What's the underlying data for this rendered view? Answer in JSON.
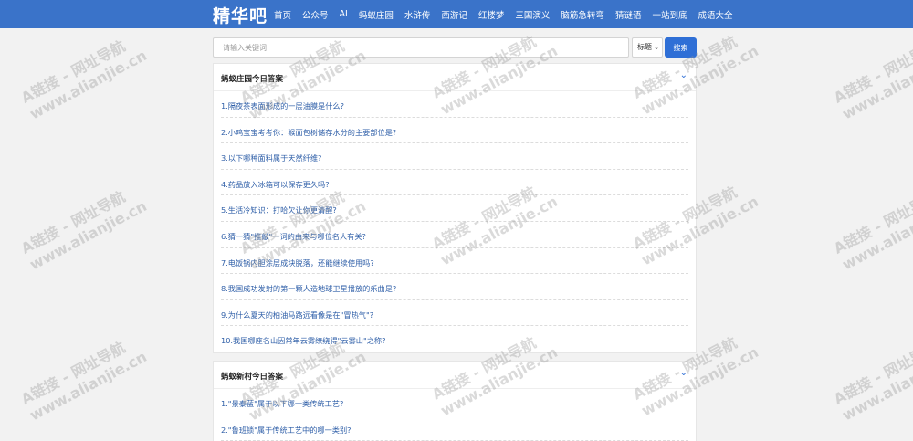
{
  "header": {
    "brand": "精华吧",
    "nav": [
      "首页",
      "公众号",
      "AI",
      "蚂蚁庄园",
      "水浒传",
      "西游记",
      "红楼梦",
      "三国演义",
      "脑筋急转弯",
      "猜谜语",
      "一站到底",
      "成语大全"
    ]
  },
  "search": {
    "placeholder": "请输入关键词",
    "select_value": "标题",
    "button_label": "搜索"
  },
  "sections": [
    {
      "title": "蚂蚁庄园今日答案",
      "toggle_icon": "chevron-down-icon",
      "items": [
        "1.隔夜茶表面形成的一层油膜是什么?",
        "2.小鸡宝宝考考你：猴面包树储存水分的主要部位是?",
        "3.以下哪种面料属于天然纤维?",
        "4.药品放入冰箱可以保存更久吗?",
        "5.生活冷知识：打哈欠让你更清醒?",
        "6.猜一猜\"推敲\"一词的由来与哪位名人有关?",
        "7.电饭锅内胆涂层成块脱落，还能继续使用吗?",
        "8.我国成功发射的第一颗人造地球卫星播放的乐曲是?",
        "9.为什么夏天的柏油马路远看像是在\"冒热气\"?",
        "10.我国哪座名山因常年云雾缭绕得\"云雾山\"之称?"
      ]
    },
    {
      "title": "蚂蚁新村今日答案",
      "toggle_icon": "chevron-down-icon",
      "items": [
        "1.\"景泰蓝\"属于以下哪一类传统工艺?",
        "2.\"鲁班锁\"属于传统工艺中的哪一类别?"
      ]
    }
  ],
  "watermark": {
    "line1": "A链接 - 网址导航",
    "line2": "www.alianjie.cn"
  }
}
